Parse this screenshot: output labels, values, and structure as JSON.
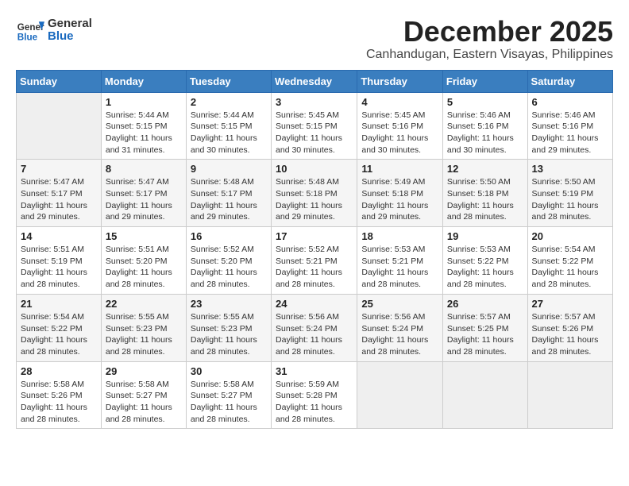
{
  "header": {
    "logo_line1": "General",
    "logo_line2": "Blue",
    "month": "December 2025",
    "location": "Canhandugan, Eastern Visayas, Philippines"
  },
  "weekdays": [
    "Sunday",
    "Monday",
    "Tuesday",
    "Wednesday",
    "Thursday",
    "Friday",
    "Saturday"
  ],
  "weeks": [
    [
      {
        "day": "",
        "sunrise": "",
        "sunset": "",
        "daylight": ""
      },
      {
        "day": "1",
        "sunrise": "Sunrise: 5:44 AM",
        "sunset": "Sunset: 5:15 PM",
        "daylight": "Daylight: 11 hours and 31 minutes."
      },
      {
        "day": "2",
        "sunrise": "Sunrise: 5:44 AM",
        "sunset": "Sunset: 5:15 PM",
        "daylight": "Daylight: 11 hours and 30 minutes."
      },
      {
        "day": "3",
        "sunrise": "Sunrise: 5:45 AM",
        "sunset": "Sunset: 5:15 PM",
        "daylight": "Daylight: 11 hours and 30 minutes."
      },
      {
        "day": "4",
        "sunrise": "Sunrise: 5:45 AM",
        "sunset": "Sunset: 5:16 PM",
        "daylight": "Daylight: 11 hours and 30 minutes."
      },
      {
        "day": "5",
        "sunrise": "Sunrise: 5:46 AM",
        "sunset": "Sunset: 5:16 PM",
        "daylight": "Daylight: 11 hours and 30 minutes."
      },
      {
        "day": "6",
        "sunrise": "Sunrise: 5:46 AM",
        "sunset": "Sunset: 5:16 PM",
        "daylight": "Daylight: 11 hours and 29 minutes."
      }
    ],
    [
      {
        "day": "7",
        "sunrise": "Sunrise: 5:47 AM",
        "sunset": "Sunset: 5:17 PM",
        "daylight": "Daylight: 11 hours and 29 minutes."
      },
      {
        "day": "8",
        "sunrise": "Sunrise: 5:47 AM",
        "sunset": "Sunset: 5:17 PM",
        "daylight": "Daylight: 11 hours and 29 minutes."
      },
      {
        "day": "9",
        "sunrise": "Sunrise: 5:48 AM",
        "sunset": "Sunset: 5:17 PM",
        "daylight": "Daylight: 11 hours and 29 minutes."
      },
      {
        "day": "10",
        "sunrise": "Sunrise: 5:48 AM",
        "sunset": "Sunset: 5:18 PM",
        "daylight": "Daylight: 11 hours and 29 minutes."
      },
      {
        "day": "11",
        "sunrise": "Sunrise: 5:49 AM",
        "sunset": "Sunset: 5:18 PM",
        "daylight": "Daylight: 11 hours and 29 minutes."
      },
      {
        "day": "12",
        "sunrise": "Sunrise: 5:50 AM",
        "sunset": "Sunset: 5:18 PM",
        "daylight": "Daylight: 11 hours and 28 minutes."
      },
      {
        "day": "13",
        "sunrise": "Sunrise: 5:50 AM",
        "sunset": "Sunset: 5:19 PM",
        "daylight": "Daylight: 11 hours and 28 minutes."
      }
    ],
    [
      {
        "day": "14",
        "sunrise": "Sunrise: 5:51 AM",
        "sunset": "Sunset: 5:19 PM",
        "daylight": "Daylight: 11 hours and 28 minutes."
      },
      {
        "day": "15",
        "sunrise": "Sunrise: 5:51 AM",
        "sunset": "Sunset: 5:20 PM",
        "daylight": "Daylight: 11 hours and 28 minutes."
      },
      {
        "day": "16",
        "sunrise": "Sunrise: 5:52 AM",
        "sunset": "Sunset: 5:20 PM",
        "daylight": "Daylight: 11 hours and 28 minutes."
      },
      {
        "day": "17",
        "sunrise": "Sunrise: 5:52 AM",
        "sunset": "Sunset: 5:21 PM",
        "daylight": "Daylight: 11 hours and 28 minutes."
      },
      {
        "day": "18",
        "sunrise": "Sunrise: 5:53 AM",
        "sunset": "Sunset: 5:21 PM",
        "daylight": "Daylight: 11 hours and 28 minutes."
      },
      {
        "day": "19",
        "sunrise": "Sunrise: 5:53 AM",
        "sunset": "Sunset: 5:22 PM",
        "daylight": "Daylight: 11 hours and 28 minutes."
      },
      {
        "day": "20",
        "sunrise": "Sunrise: 5:54 AM",
        "sunset": "Sunset: 5:22 PM",
        "daylight": "Daylight: 11 hours and 28 minutes."
      }
    ],
    [
      {
        "day": "21",
        "sunrise": "Sunrise: 5:54 AM",
        "sunset": "Sunset: 5:22 PM",
        "daylight": "Daylight: 11 hours and 28 minutes."
      },
      {
        "day": "22",
        "sunrise": "Sunrise: 5:55 AM",
        "sunset": "Sunset: 5:23 PM",
        "daylight": "Daylight: 11 hours and 28 minutes."
      },
      {
        "day": "23",
        "sunrise": "Sunrise: 5:55 AM",
        "sunset": "Sunset: 5:23 PM",
        "daylight": "Daylight: 11 hours and 28 minutes."
      },
      {
        "day": "24",
        "sunrise": "Sunrise: 5:56 AM",
        "sunset": "Sunset: 5:24 PM",
        "daylight": "Daylight: 11 hours and 28 minutes."
      },
      {
        "day": "25",
        "sunrise": "Sunrise: 5:56 AM",
        "sunset": "Sunset: 5:24 PM",
        "daylight": "Daylight: 11 hours and 28 minutes."
      },
      {
        "day": "26",
        "sunrise": "Sunrise: 5:57 AM",
        "sunset": "Sunset: 5:25 PM",
        "daylight": "Daylight: 11 hours and 28 minutes."
      },
      {
        "day": "27",
        "sunrise": "Sunrise: 5:57 AM",
        "sunset": "Sunset: 5:26 PM",
        "daylight": "Daylight: 11 hours and 28 minutes."
      }
    ],
    [
      {
        "day": "28",
        "sunrise": "Sunrise: 5:58 AM",
        "sunset": "Sunset: 5:26 PM",
        "daylight": "Daylight: 11 hours and 28 minutes."
      },
      {
        "day": "29",
        "sunrise": "Sunrise: 5:58 AM",
        "sunset": "Sunset: 5:27 PM",
        "daylight": "Daylight: 11 hours and 28 minutes."
      },
      {
        "day": "30",
        "sunrise": "Sunrise: 5:58 AM",
        "sunset": "Sunset: 5:27 PM",
        "daylight": "Daylight: 11 hours and 28 minutes."
      },
      {
        "day": "31",
        "sunrise": "Sunrise: 5:59 AM",
        "sunset": "Sunset: 5:28 PM",
        "daylight": "Daylight: 11 hours and 28 minutes."
      },
      {
        "day": "",
        "sunrise": "",
        "sunset": "",
        "daylight": ""
      },
      {
        "day": "",
        "sunrise": "",
        "sunset": "",
        "daylight": ""
      },
      {
        "day": "",
        "sunrise": "",
        "sunset": "",
        "daylight": ""
      }
    ]
  ]
}
